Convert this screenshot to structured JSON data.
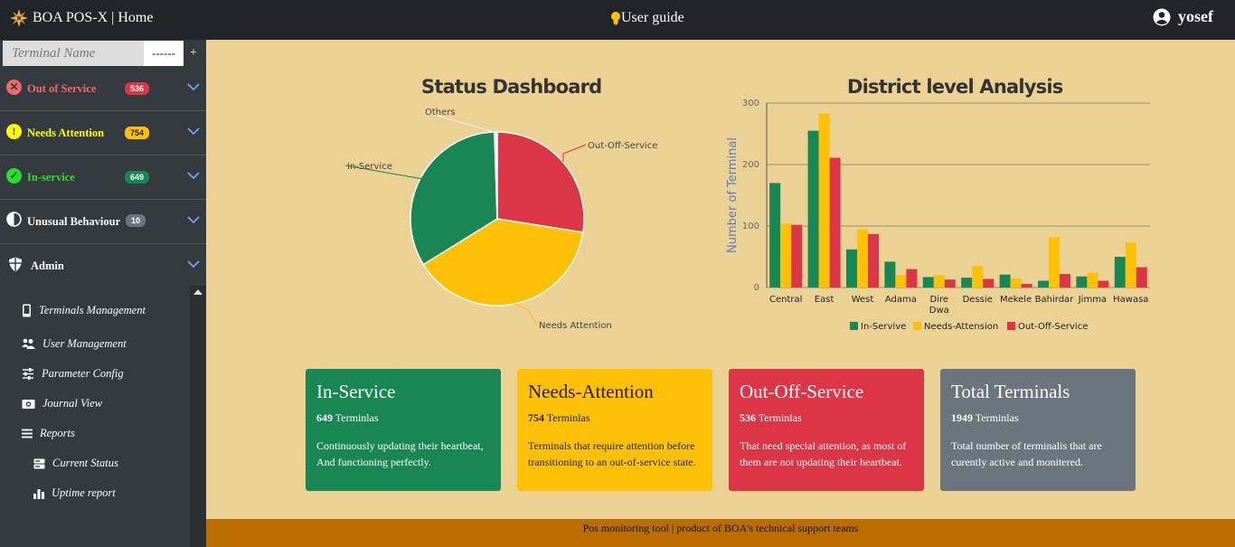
{
  "header": {
    "brand": "BOA POS-X | Home",
    "user_guide": "User guide",
    "username": "yosef"
  },
  "sidebar": {
    "search_placeholder": "Terminal Name",
    "search_dash": "------",
    "add_label": "+",
    "status_items": [
      {
        "label": "Out of Service",
        "count": "536",
        "color": "#ef6b6b",
        "badge_bg": "#dc3545"
      },
      {
        "label": "Needs Attention",
        "count": "754",
        "color": "#ffff00",
        "badge_bg": "#ffc107"
      },
      {
        "label": "In-service",
        "count": "649",
        "color": "#28e028",
        "badge_bg": "#198754"
      },
      {
        "label": "Unusual Behaviour",
        "count": "10",
        "color": "#ffffff",
        "badge_bg": "#6c757d"
      },
      {
        "label": "Admin",
        "count": "",
        "color": "#ffffff",
        "badge_bg": ""
      }
    ],
    "admin_links": [
      {
        "label": "Terminals Management",
        "icon": "mobile-icon"
      },
      {
        "label": "User Management",
        "icon": "users-icon"
      },
      {
        "label": "Parameter Config",
        "icon": "sliders-icon"
      },
      {
        "label": "Journal View",
        "icon": "journal-icon"
      },
      {
        "label": "Reports",
        "icon": "list-icon"
      },
      {
        "label": "Current Status",
        "icon": "server-icon"
      },
      {
        "label": "Uptime report",
        "icon": "bar-chart-icon"
      }
    ]
  },
  "dashboard": {
    "pie_title": "Status Dashboard",
    "bar_title": "District level Analysis"
  },
  "chart_data": [
    {
      "type": "pie",
      "title": "Status Dashboard",
      "labels": [
        "Out-Off-Service",
        "Needs Attention",
        "In-Service",
        "Others"
      ],
      "values": [
        536,
        754,
        649,
        10
      ],
      "colors": [
        "#dc3545",
        "#ffc107",
        "#198754",
        "#ffffff"
      ]
    },
    {
      "type": "bar",
      "title": "District level Analysis",
      "xlabel": "",
      "ylabel": "Number of Terminal",
      "ylim": [
        0,
        300
      ],
      "yticks": [
        0,
        100,
        200,
        300
      ],
      "categories": [
        "Central",
        "East",
        "West",
        "Adama",
        "Dire Dwa",
        "Dessie",
        "Mekele",
        "Bahirdar",
        "Jimma",
        "Hawasa"
      ],
      "series": [
        {
          "name": "In-Servive",
          "color": "#198754",
          "values": [
            170,
            255,
            62,
            42,
            17,
            16,
            21,
            11,
            18,
            50
          ]
        },
        {
          "name": "Needs-Attension",
          "color": "#ffc107",
          "values": [
            104,
            283,
            95,
            20,
            20,
            35,
            15,
            82,
            24,
            73
          ]
        },
        {
          "name": "Out-Off-Service",
          "color": "#dc3545",
          "values": [
            102,
            211,
            87,
            30,
            13,
            14,
            6,
            22,
            11,
            33
          ]
        }
      ],
      "legend": "bottom"
    }
  ],
  "cards": [
    {
      "title": "In-Service",
      "count": "649",
      "unit": "Terminlas",
      "desc": "Continuously updating their heartbeat, And functioning perfectly.",
      "bg": "#198754"
    },
    {
      "title": "Needs-Attention",
      "count": "754",
      "unit": "Terminlas",
      "desc": "Terminals that require attention before transitioning to an out-of-service state.",
      "bg": "#ffc107"
    },
    {
      "title": "Out-Off-Service",
      "count": "536",
      "unit": "Terminlas",
      "desc": "That need special attention, as most of them are not updating their heartbeat.",
      "bg": "#dc3545"
    },
    {
      "title": "Total Terminals",
      "count": "1949",
      "unit": "Terminlas",
      "desc": "Total number of terminalis that are curently active and monitered.",
      "bg": "#6c757d"
    }
  ],
  "footer": "Pos monitoring tool | product of BOA's technical support teams"
}
